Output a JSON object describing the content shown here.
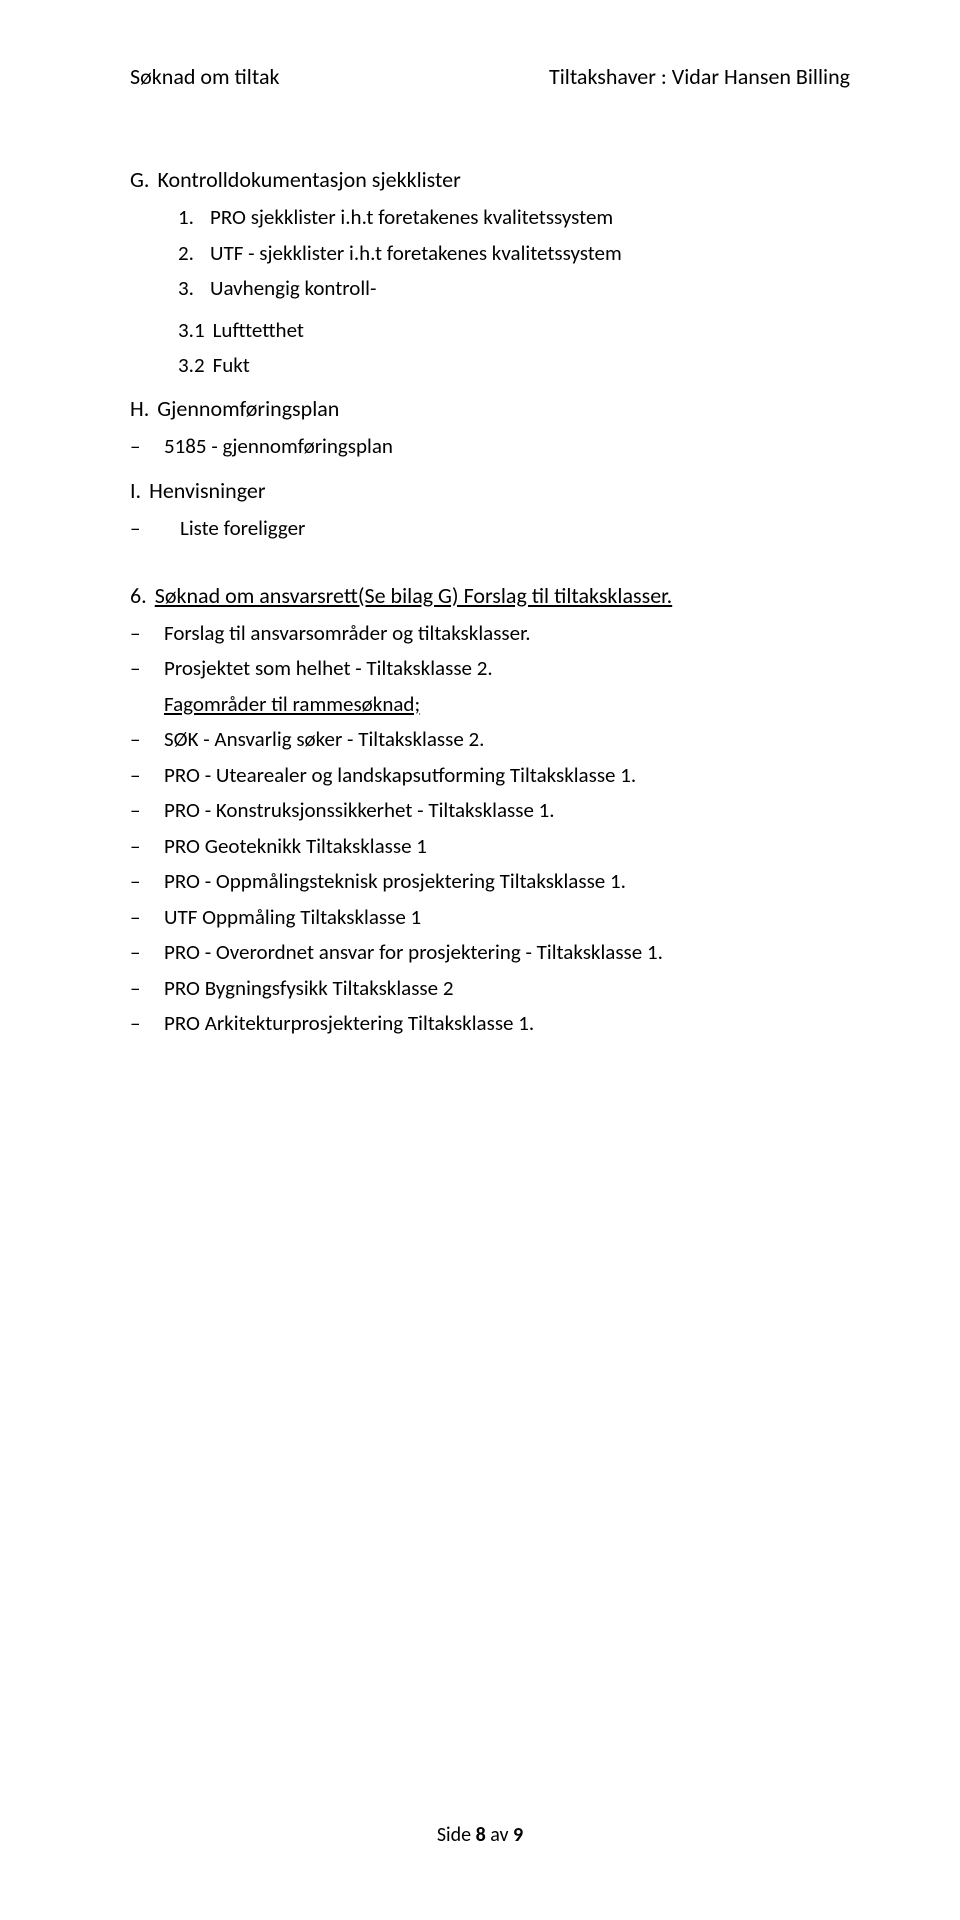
{
  "header": {
    "left": "Søknad om tiltak",
    "right": "Tiltakshaver : Vidar Hansen Billing"
  },
  "sectionG": {
    "marker": "G.",
    "title": "Kontrolldokumentasjon sjekklister",
    "items": [
      {
        "num": "1.",
        "text": "PRO sjekklister i.h.t foretakenes kvalitetssystem"
      },
      {
        "num": "2.",
        "text": "UTF - sjekklister i.h.t foretakenes kvalitetssystem"
      },
      {
        "num": "3.",
        "text": "Uavhengig kontroll-"
      }
    ],
    "subitems": [
      {
        "num": "3.1",
        "text": "Lufttetthet"
      },
      {
        "num": "3.2",
        "text": "Fukt"
      }
    ]
  },
  "sectionH": {
    "marker": "H.",
    "title": "Gjennomføringsplan",
    "items": [
      {
        "text": "5185 - gjennomføringsplan"
      }
    ]
  },
  "sectionI": {
    "marker": "I.",
    "title": "Henvisninger",
    "items": [
      {
        "text": "Liste foreligger"
      }
    ]
  },
  "section6": {
    "marker": "6.",
    "title": "Søknad om ansvarsrett(Se bilag G) Forslag til tiltaksklasser.",
    "items": [
      {
        "text": "Forslag til ansvarsområder og tiltaksklasser."
      },
      {
        "text": "Prosjektet som helhet - Tiltaksklasse 2."
      }
    ],
    "subheading": "Fagområder til rammesøknad;",
    "faglist": [
      {
        "text": "SØK - Ansvarlig søker - Tiltaksklasse 2."
      },
      {
        "text": "PRO - Utearealer og landskapsutforming Tiltaksklasse 1."
      },
      {
        "text": "PRO - Konstruksjonssikkerhet - Tiltaksklasse 1."
      },
      {
        "text": "PRO Geoteknikk Tiltaksklasse 1"
      },
      {
        "text": "PRO - Oppmålingsteknisk prosjektering Tiltaksklasse 1."
      },
      {
        "text": "UTF Oppmåling Tiltaksklasse 1"
      },
      {
        "text": "PRO - Overordnet ansvar for prosjektering - Tiltaksklasse 1."
      },
      {
        "text": "PRO Bygningsfysikk Tiltaksklasse 2"
      },
      {
        "text": "PRO Arkitekturprosjektering Tiltaksklasse 1."
      }
    ]
  },
  "footer": {
    "side": "Side ",
    "page": "8",
    "av": " av ",
    "total": "9"
  }
}
